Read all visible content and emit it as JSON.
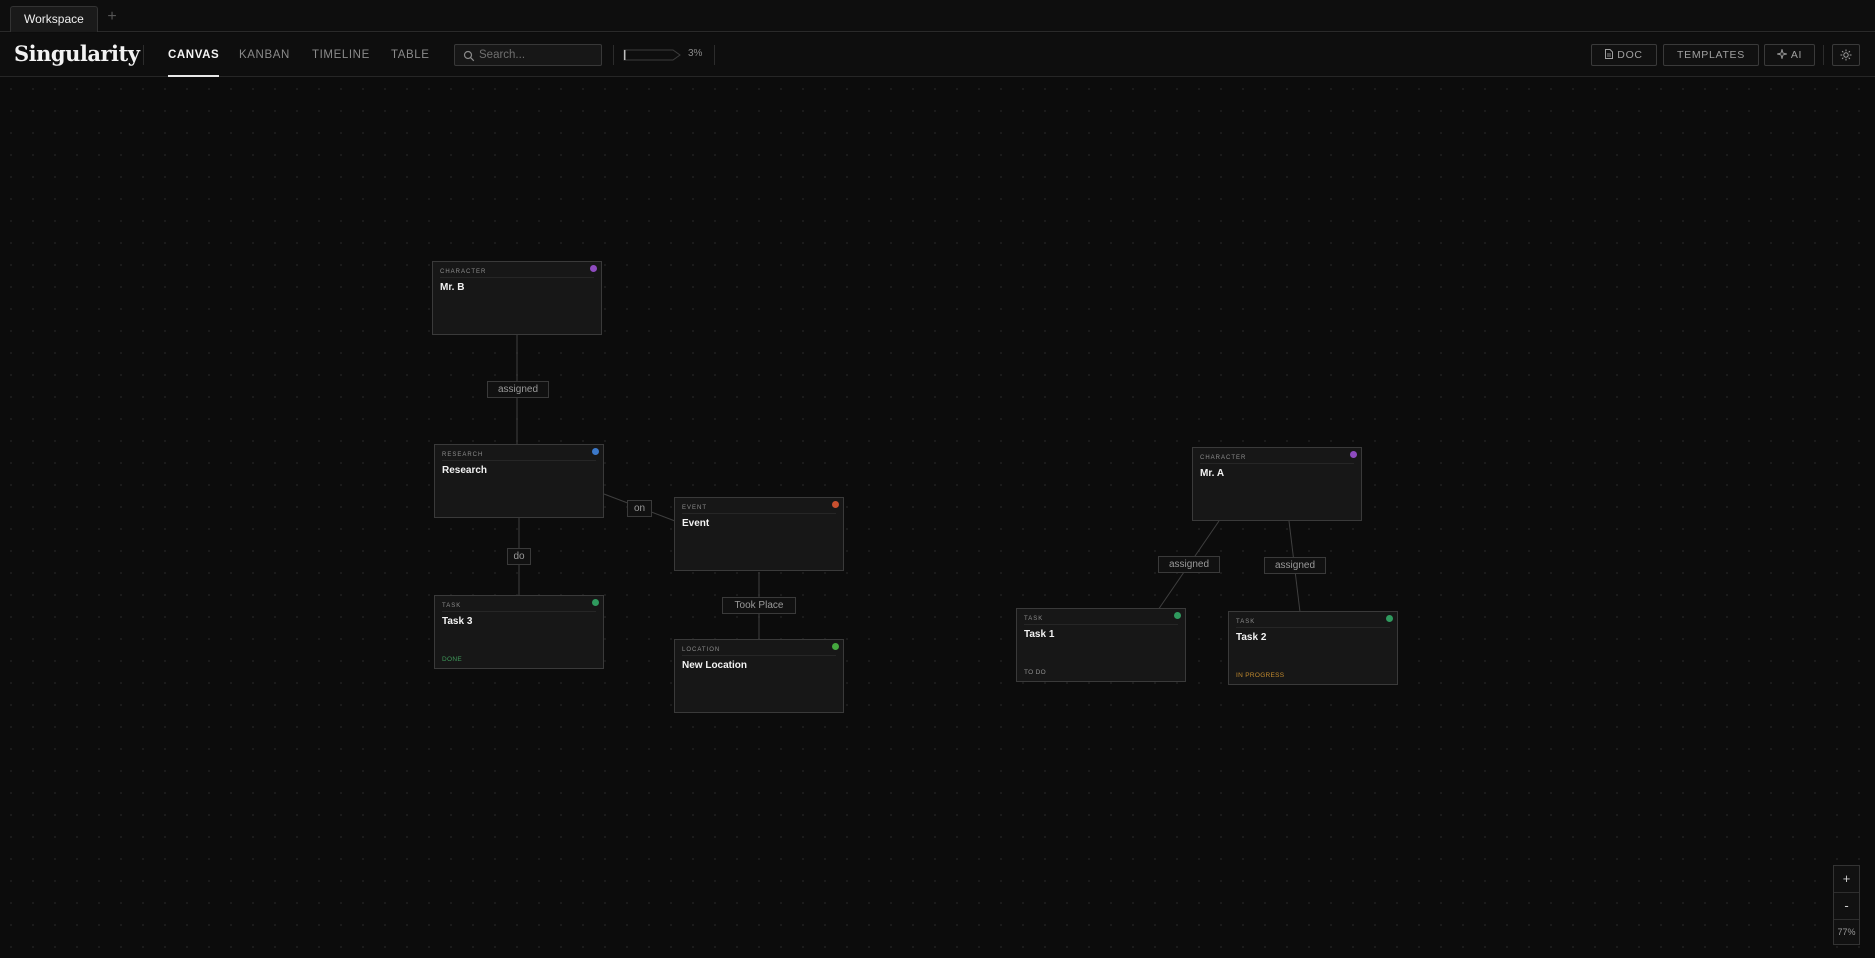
{
  "tabs": {
    "workspace": "Workspace",
    "add": "+"
  },
  "header": {
    "brand": "Singularity",
    "nav": {
      "canvas": "CANVAS",
      "kanban": "KANBAN",
      "timeline": "TIMELINE",
      "table": "TABLE"
    },
    "search_placeholder": "Search...",
    "progress_value": 0.03,
    "progress_label": "3%",
    "doc_label": "DOC",
    "templates_label": "TEMPLATES",
    "ai_label": "AI"
  },
  "nodes": {
    "mr_b": {
      "type": "CHARACTER",
      "title": "Mr. B",
      "dot": "#8e4bbf"
    },
    "research": {
      "type": "RESEARCH",
      "title": "Research",
      "dot": "#3b78c9"
    },
    "event": {
      "type": "EVENT",
      "title": "Event",
      "dot": "#c8502f"
    },
    "task3": {
      "type": "TASK",
      "title": "Task 3",
      "dot": "#2f9a5e",
      "status": "DONE",
      "status_color": "#3f9a5a"
    },
    "new_location": {
      "type": "LOCATION",
      "title": "New Location",
      "dot": "#45a83f"
    },
    "mr_a": {
      "type": "CHARACTER",
      "title": "Mr. A",
      "dot": "#8e4bbf"
    },
    "task1": {
      "type": "TASK",
      "title": "Task 1",
      "dot": "#2f9a5e",
      "status": "TO DO",
      "status_color": "#8f8f8f"
    },
    "task2": {
      "type": "TASK",
      "title": "Task 2",
      "dot": "#2f9a5e",
      "status": "IN PROGRESS",
      "status_color": "#c28a2e"
    }
  },
  "edges": {
    "mrb_research": "assigned",
    "research_event": "on",
    "research_task3": "do",
    "event_location": "Took Place",
    "mra_task1": "assigned",
    "mra_task2": "assigned"
  },
  "zoom": {
    "in": "+",
    "out": "-",
    "level": "77%"
  }
}
